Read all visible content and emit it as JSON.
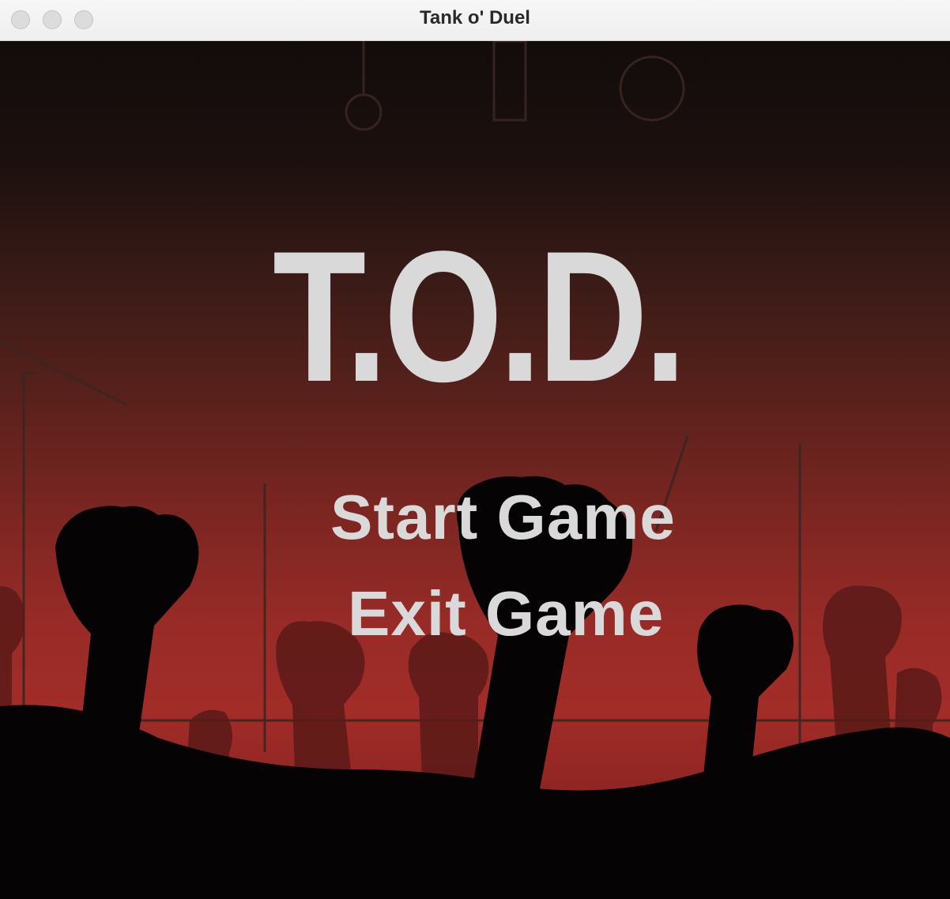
{
  "window": {
    "title": "Tank o' Duel"
  },
  "game": {
    "logo": "T.O.D.",
    "menu": {
      "start_label": "Start Game",
      "exit_label": "Exit Game"
    }
  },
  "colors": {
    "logo_text": "#d9d9d9",
    "background_red": "#a22c28",
    "silhouette": "#000000"
  }
}
